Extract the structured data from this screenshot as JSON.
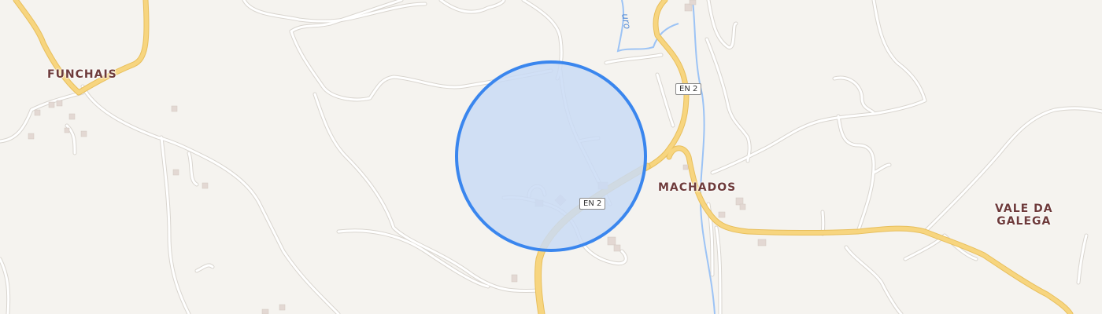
{
  "map": {
    "places": {
      "funchais": "FUNCHAIS",
      "machados": "MACHADOS",
      "vale_da_galega_line1": "VALE DA",
      "vale_da_galega_line2": "GALEGA"
    },
    "road_shields": {
      "upper": "EN 2",
      "lower": "EN 2"
    },
    "river_label": "uro",
    "colors": {
      "background": "#f5f3ef",
      "minor_road": "#ffffff",
      "main_road": "#f7d57f",
      "main_road_casing": "#e8bf5c",
      "river": "#9cc3f5",
      "building": "#e3d8d3",
      "accuracy_fill": "#c9dbf5",
      "accuracy_stroke": "#3a86ee",
      "place_label": "#6e3b3b"
    }
  }
}
